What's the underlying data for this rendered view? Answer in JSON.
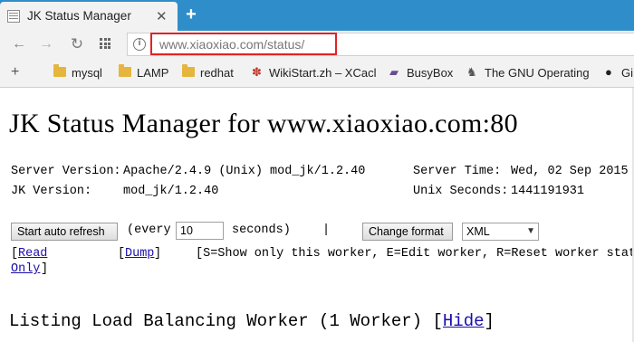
{
  "tab": {
    "title": "JK Status Manager",
    "close": "✕",
    "new_tab": "+"
  },
  "nav": {
    "back": "←",
    "forward": "→",
    "reload": "↻",
    "page_icon": "i"
  },
  "address": {
    "url": "www.xiaoxiao.com/status/"
  },
  "bookmarks": {
    "add": "+",
    "items": [
      {
        "label": "mysql",
        "icon": "folder-icon"
      },
      {
        "label": "LAMP",
        "icon": "folder-icon"
      },
      {
        "label": "redhat",
        "icon": "folder-icon"
      },
      {
        "label": "WikiStart.zh – XCacl",
        "icon": "wiki-paw-icon"
      },
      {
        "label": "BusyBox",
        "icon": "busybox-icon"
      },
      {
        "label": "The GNU Operating",
        "icon": "gnu-icon"
      },
      {
        "label": "Gi",
        "icon": "github-icon"
      }
    ]
  },
  "page": {
    "title": "JK Status Manager for www.xiaoxiao.com:80",
    "server_version_label": "Server Version:",
    "server_version_value": "Apache/2.4.9 (Unix) mod_jk/1.2.40",
    "jk_version_label": "JK Version:",
    "jk_version_value": "mod_jk/1.2.40",
    "server_time_label": "Server Time:",
    "server_time_value": "Wed, 02 Sep 2015",
    "unix_seconds_label": "Unix Seconds:",
    "unix_seconds_value": "1441191931",
    "refresh_button": "Start auto refresh",
    "every_label": "(every",
    "refresh_seconds": "10",
    "seconds_label": "seconds)",
    "separator": "|",
    "change_format_button": "Change format",
    "format_selected": "XML",
    "read_only_open": "[",
    "read_only_link_1": "Read",
    "read_only_link_2": "Only",
    "read_only_close": "]",
    "dump_open": "[",
    "dump_link": "Dump",
    "dump_close": "]",
    "legend_text": "[S=Show only this worker, E=Edit worker, R=Reset worker state",
    "listing_heading": "Listing Load Balancing Worker (1 Worker) [",
    "hide_link": "Hide",
    "listing_close": "]"
  },
  "colors": {
    "tabstrip": "#2f8ec9",
    "url_highlight": "#e02424",
    "link": "#1a0dab"
  }
}
